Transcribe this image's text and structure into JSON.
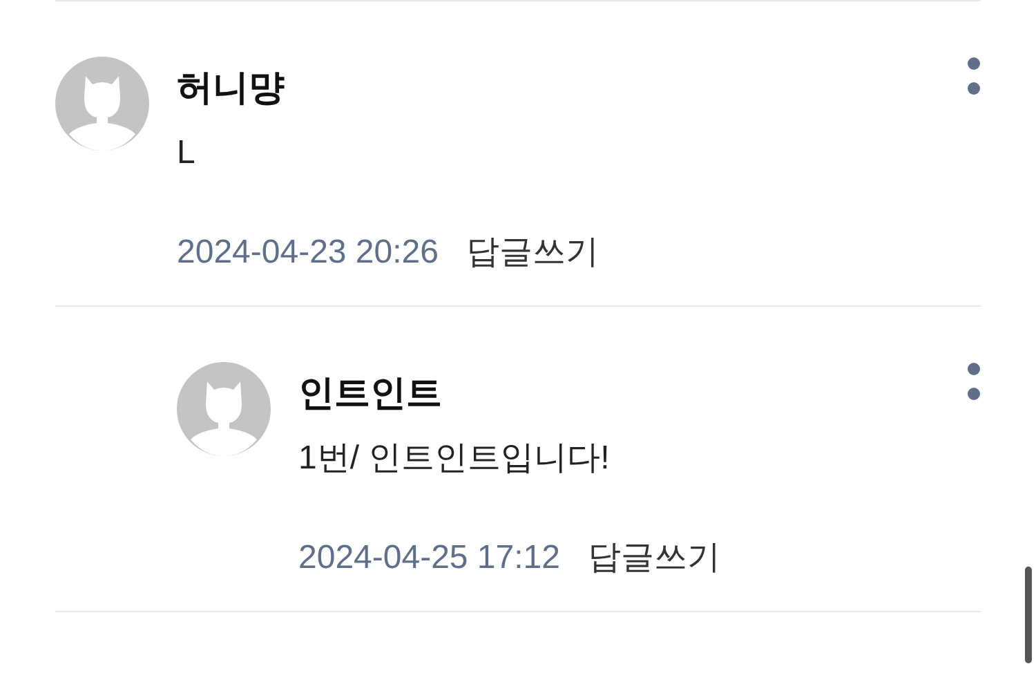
{
  "comments": [
    {
      "author": "허니먕",
      "text": "L",
      "date": "2024-04-23 20:26",
      "reply_label": "답글쓰기",
      "children": [
        {
          "author": "인트인트",
          "text": "1번/ 인트인트입니다!",
          "date": "2024-04-25 17:12",
          "reply_label": "답글쓰기"
        }
      ]
    }
  ]
}
